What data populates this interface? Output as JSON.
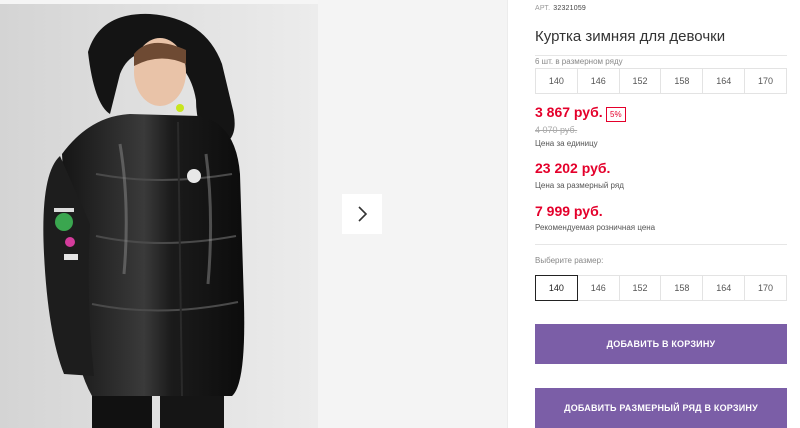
{
  "gallery": {
    "next_icon": "chevron-right-icon"
  },
  "product": {
    "article_label": "АРТ.",
    "article_number": "32321059",
    "title": "Куртка зимняя для девочки",
    "series_caption": "6 шт. в размерном ряду",
    "series_sizes": [
      "140",
      "146",
      "152",
      "158",
      "164",
      "170"
    ],
    "price": "3 867 руб.",
    "discount": "5%",
    "old_price": "4 070 руб.",
    "unit_caption": "Цена за единицу",
    "series_price": "23 202 руб.",
    "series_price_caption": "Цена за размерный ряд",
    "retail_price": "7 999 руб.",
    "retail_caption": "Рекомендуемая розничная цена",
    "choose_size_caption": "Выберите размер:",
    "sizes": [
      "140",
      "146",
      "152",
      "158",
      "164",
      "170"
    ],
    "selected_size": "140",
    "add_to_cart": "ДОБАВИТЬ В КОРЗИНУ",
    "add_series_to_cart": "ДОБАВИТЬ РАЗМЕРНЫЙ РЯД В КОРЗИНУ"
  },
  "colors": {
    "accent": "#7b5ea7",
    "price_red": "#e4002b"
  }
}
